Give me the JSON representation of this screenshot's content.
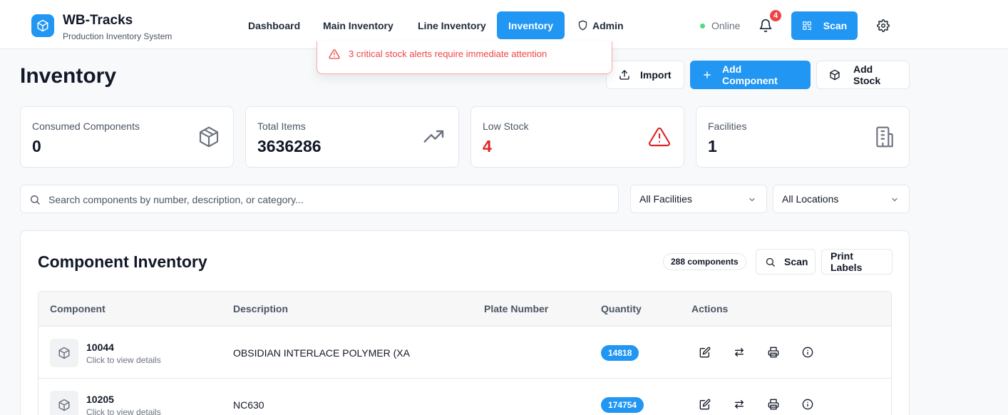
{
  "header": {
    "app_name": "WB-Tracks",
    "app_subtitle": "Production Inventory System",
    "logo_icon": "cube-icon",
    "nav": [
      {
        "label": "Dashboard",
        "active": false
      },
      {
        "label": "Main Inventory",
        "active": false
      },
      {
        "label": "Line Inventory",
        "active": false
      },
      {
        "label": "Inventory",
        "active": true
      },
      {
        "label": "Admin",
        "icon": "shield-icon",
        "active": false
      }
    ],
    "status": "Online",
    "notification_count": "4",
    "scan_label": "Scan",
    "accent_color": "#2196f3"
  },
  "alert": {
    "text": "3 critical stock alerts require immediate attention",
    "color": "#ef4444"
  },
  "page": {
    "title": "Inventory",
    "actions": {
      "import_label": "Import",
      "add_component_label": "Add Component",
      "add_stock_label": "Add Stock"
    }
  },
  "stats": [
    {
      "label": "Consumed Components",
      "value": "0",
      "icon": "package-icon"
    },
    {
      "label": "Total Items",
      "value": "3636286",
      "icon": "trending-up-icon"
    },
    {
      "label": "Low Stock",
      "value": "4",
      "icon": "warning-icon",
      "value_color": "#dc2626"
    },
    {
      "label": "Facilities",
      "value": "1",
      "icon": "building-icon"
    }
  ],
  "filters": {
    "search_placeholder": "Search components by number, description, or category...",
    "facility": "All Facilities",
    "location": "All Locations"
  },
  "inventory": {
    "title": "Component Inventory",
    "count_label": "288 components",
    "scan_label": "Scan",
    "print_labels": "Print Labels",
    "columns": [
      "Component",
      "Description",
      "Plate Number",
      "Quantity",
      "Actions"
    ],
    "rows": [
      {
        "component": "10044",
        "hint": "Click to view details",
        "description": "OBSIDIAN INTERLACE POLYMER (XA",
        "plate_number": "",
        "quantity": "14818"
      },
      {
        "component": "10205",
        "hint": "Click to view details",
        "description": "NC630",
        "plate_number": "",
        "quantity": "174754"
      }
    ]
  }
}
